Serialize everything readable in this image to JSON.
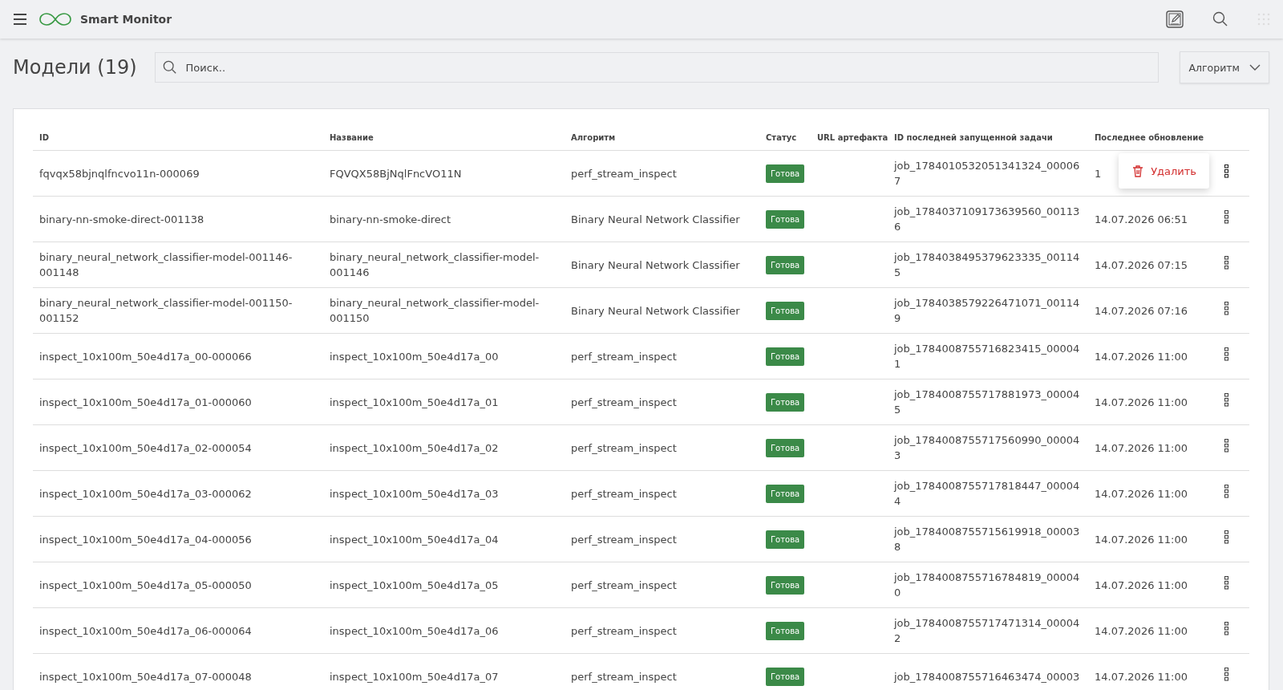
{
  "app": {
    "name": "Smart Monitor"
  },
  "page": {
    "title": "Модели (19)"
  },
  "search": {
    "placeholder": "Поиск.."
  },
  "filter": {
    "label": "Алгоритм"
  },
  "table": {
    "columns": [
      "ID",
      "Название",
      "Алгоритм",
      "Статус",
      "URL артефакта",
      "ID последней запущенной задачи",
      "Последнее обновление"
    ],
    "rows": [
      {
        "id": "fqvqx58bjnqlfncvo11n-000069",
        "name": "FQVQX58BjNqlFncVO11N",
        "algorithm": "perf_stream_inspect",
        "status": "Готова",
        "job": "job_1784010532051341324_000067",
        "updated": "1",
        "menu_open": true
      },
      {
        "id": "binary-nn-smoke-direct-001138",
        "name": "binary-nn-smoke-direct",
        "algorithm": "Binary Neural Network Classifier",
        "status": "Готова",
        "job": "job_1784037109173639560_001136",
        "updated": "14.07.2026 06:51",
        "menu_open": false
      },
      {
        "id": "binary_neural_network_classifier-model-001146-001148",
        "name": "binary_neural_network_classifier-model-001146",
        "algorithm": "Binary Neural Network Classifier",
        "status": "Готова",
        "job": "job_1784038495379623335_001145",
        "updated": "14.07.2026 07:15",
        "menu_open": false
      },
      {
        "id": "binary_neural_network_classifier-model-001150-001152",
        "name": "binary_neural_network_classifier-model-001150",
        "algorithm": "Binary Neural Network Classifier",
        "status": "Готова",
        "job": "job_1784038579226471071_001149",
        "updated": "14.07.2026 07:16",
        "menu_open": false
      },
      {
        "id": "inspect_10x100m_50e4d17a_00-000066",
        "name": "inspect_10x100m_50e4d17a_00",
        "algorithm": "perf_stream_inspect",
        "status": "Готова",
        "job": "job_1784008755716823415_000041",
        "updated": "14.07.2026 11:00",
        "menu_open": false
      },
      {
        "id": "inspect_10x100m_50e4d17a_01-000060",
        "name": "inspect_10x100m_50e4d17a_01",
        "algorithm": "perf_stream_inspect",
        "status": "Готова",
        "job": "job_1784008755717881973_000045",
        "updated": "14.07.2026 11:00",
        "menu_open": false
      },
      {
        "id": "inspect_10x100m_50e4d17a_02-000054",
        "name": "inspect_10x100m_50e4d17a_02",
        "algorithm": "perf_stream_inspect",
        "status": "Готова",
        "job": "job_1784008755717560990_000043",
        "updated": "14.07.2026 11:00",
        "menu_open": false
      },
      {
        "id": "inspect_10x100m_50e4d17a_03-000062",
        "name": "inspect_10x100m_50e4d17a_03",
        "algorithm": "perf_stream_inspect",
        "status": "Готова",
        "job": "job_1784008755717818447_000044",
        "updated": "14.07.2026 11:00",
        "menu_open": false
      },
      {
        "id": "inspect_10x100m_50e4d17a_04-000056",
        "name": "inspect_10x100m_50e4d17a_04",
        "algorithm": "perf_stream_inspect",
        "status": "Готова",
        "job": "job_1784008755715619918_000038",
        "updated": "14.07.2026 11:00",
        "menu_open": false
      },
      {
        "id": "inspect_10x100m_50e4d17a_05-000050",
        "name": "inspect_10x100m_50e4d17a_05",
        "algorithm": "perf_stream_inspect",
        "status": "Готова",
        "job": "job_1784008755716784819_000040",
        "updated": "14.07.2026 11:00",
        "menu_open": false
      },
      {
        "id": "inspect_10x100m_50e4d17a_06-000064",
        "name": "inspect_10x100m_50e4d17a_06",
        "algorithm": "perf_stream_inspect",
        "status": "Готова",
        "job": "job_1784008755717471314_000042",
        "updated": "14.07.2026 11:00",
        "menu_open": false
      },
      {
        "id": "inspect_10x100m_50e4d17a_07-000048",
        "name": "inspect_10x100m_50e4d17a_07",
        "algorithm": "perf_stream_inspect",
        "status": "Готова",
        "job": "job_1784008755716463474_00003",
        "updated": "14.07.2026 11:00",
        "menu_open": false
      }
    ]
  },
  "row_menu": {
    "items": [
      {
        "label": "Удалить",
        "kind": "danger"
      }
    ]
  }
}
